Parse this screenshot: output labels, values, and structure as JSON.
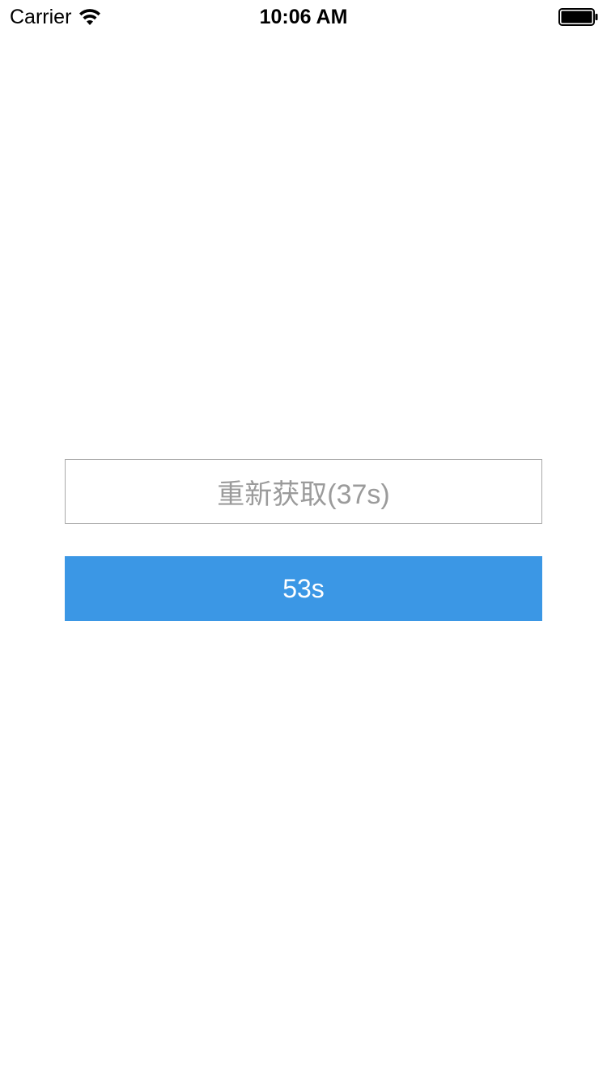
{
  "status_bar": {
    "carrier": "Carrier",
    "time": "10:06 AM",
    "wifi_icon": "wifi-icon",
    "battery_icon": "battery-full-icon"
  },
  "main": {
    "retry_button": {
      "label": "重新获取(37s)",
      "text_color": "#9b9b9b",
      "border_color": "#a9a9a9"
    },
    "countdown_button": {
      "label": "53s",
      "background_color": "#3b97e5",
      "text_color": "#ffffff"
    }
  }
}
